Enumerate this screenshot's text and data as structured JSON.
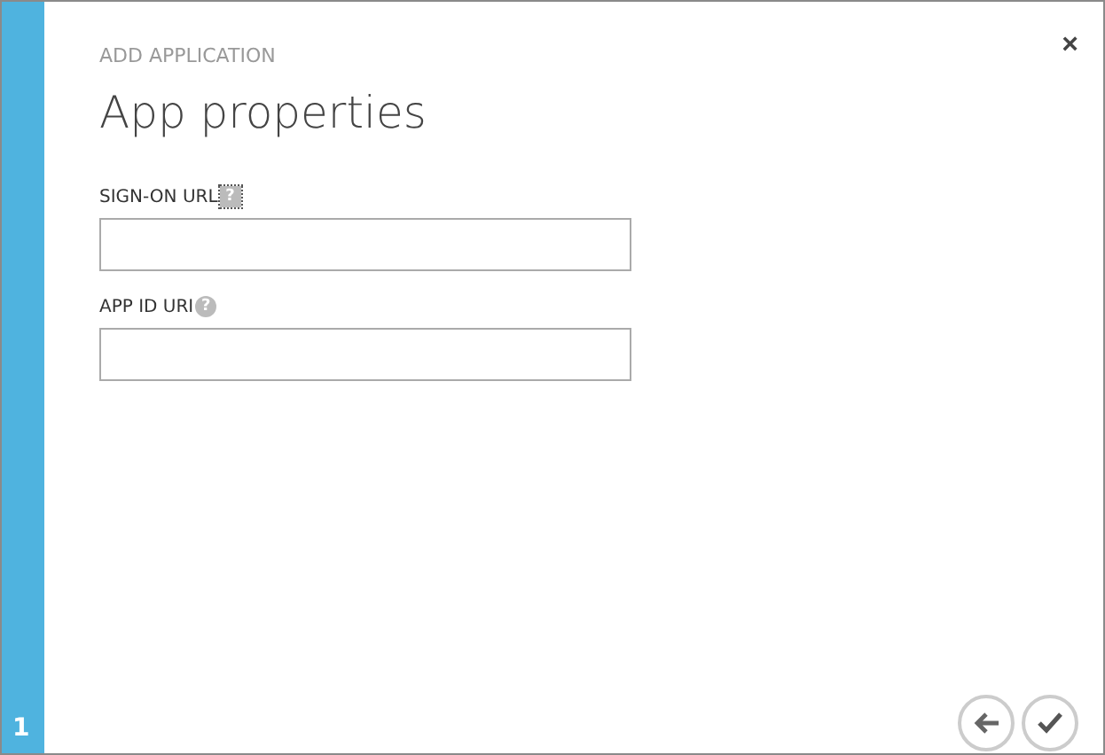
{
  "wizard": {
    "step": "1",
    "close": "×",
    "subtitle": "ADD APPLICATION",
    "title": "App properties"
  },
  "fields": [
    {
      "label": "SIGN-ON URL",
      "help": "?",
      "help_focused": true
    },
    {
      "label": "APP ID URI",
      "help": "?",
      "help_focused": false
    }
  ],
  "buttons": [
    {
      "kind": "back"
    },
    {
      "kind": "finish"
    }
  ]
}
